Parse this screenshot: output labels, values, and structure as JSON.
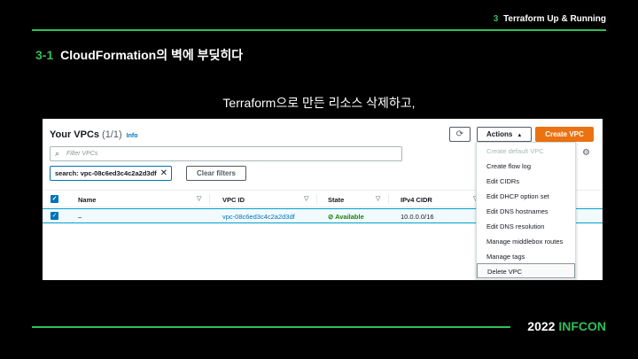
{
  "slide": {
    "brand_num": "3",
    "brand_label": "Terraform Up & Running",
    "section_num": "3-1",
    "section_title": "CloudFormation의 벽에 부딪히다",
    "subtitle": "Terraform으로 만든 리소스 삭제하고,",
    "footer_year": "2022",
    "footer_brand": "INFCON"
  },
  "console": {
    "header_title": "Your VPCs",
    "header_count": "(1/1)",
    "info_link": "Info",
    "actions_label": "Actions",
    "create_label": "Create VPC",
    "filter_placeholder": "Filter VPCs",
    "filter_chip": "search: vpc-08c6ed3c4c2a2d3df",
    "clear_label": "Clear filters",
    "columns": [
      "Name",
      "VPC ID",
      "State",
      "IPv4 CIDR"
    ],
    "row": {
      "name": "–",
      "vpc_id": "vpc-08c6ed3c4c2a2d3df",
      "state": "Available",
      "cidr": "10.0.0.0/16"
    },
    "menu": [
      "Create default VPC",
      "Create flow log",
      "Edit CIDRs",
      "Edit DHCP option set",
      "Edit DNS hostnames",
      "Edit DNS resolution",
      "Manage middlebox routes",
      "Manage tags",
      "Delete VPC"
    ],
    "colors": {
      "accent": "#ec7211",
      "link": "#0073bb",
      "ok": "#1d8102",
      "brand_green": "#2fbf5a"
    },
    "icons": [
      "refresh-icon",
      "caret-up-icon",
      "search-icon",
      "close-icon",
      "gear-icon",
      "sort-icon",
      "check-circle-icon",
      "checkbox-checked-icon"
    ]
  }
}
